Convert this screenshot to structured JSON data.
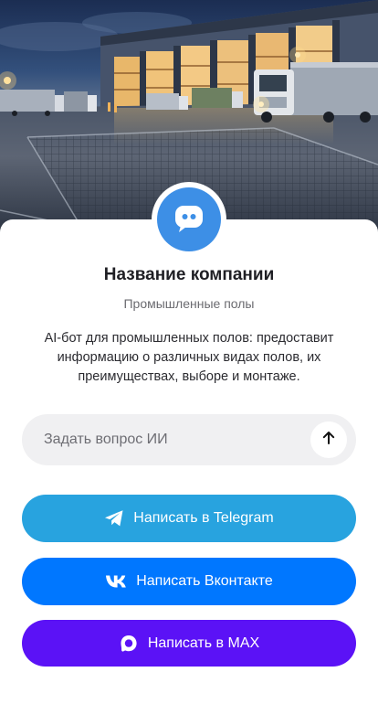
{
  "company": {
    "name": "Название компании",
    "category": "Промышленные полы",
    "description": "AI-бот для промышленных полов: предоставит информацию о различных видах полов, их преимуществах, выборе и монтаже."
  },
  "ask": {
    "placeholder": "Задать вопрос ИИ",
    "send_icon": "arrow-up-icon"
  },
  "actions": [
    {
      "label": "Написать в Telegram",
      "icon": "telegram-icon",
      "color": "#28a3df"
    },
    {
      "label": "Написать Вконтакте",
      "icon": "vk-icon",
      "color": "#0077ff"
    },
    {
      "label": "Написать в MAX",
      "icon": "max-icon",
      "color": "#5b12f6"
    }
  ],
  "avatar": {
    "icon": "chat-bot-icon",
    "color": "#3d8fe6"
  },
  "hero": {
    "image": "warehouse-industrial-floor-image"
  }
}
